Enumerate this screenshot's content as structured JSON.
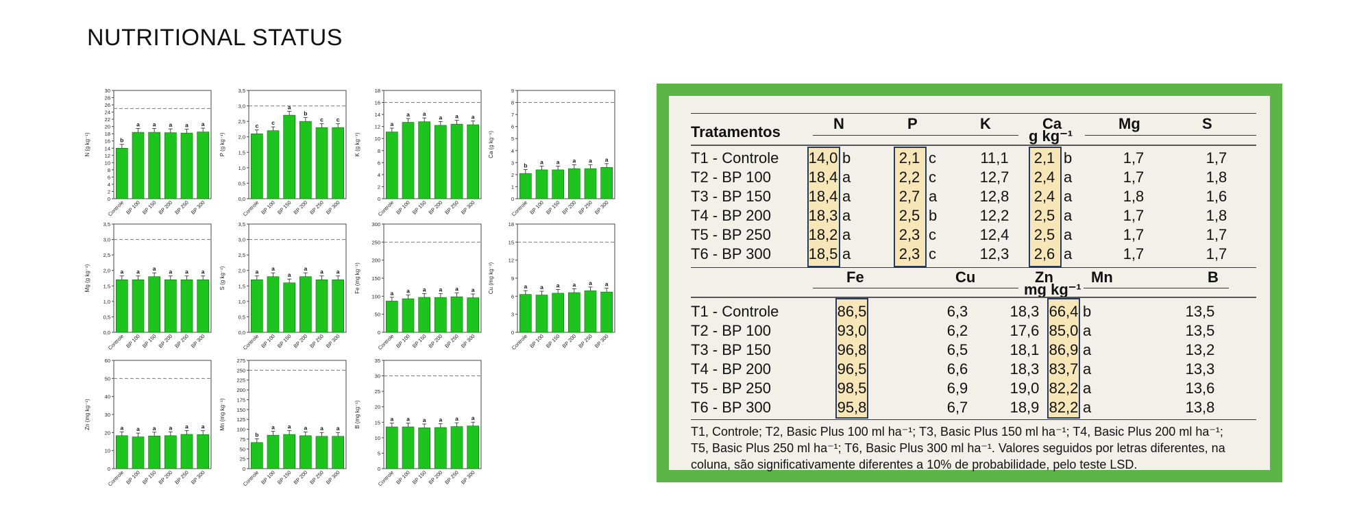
{
  "title": "NUTRITIONAL STATUS",
  "chart_data": [
    {
      "type": "bar",
      "ylabel": "N (g kg⁻¹)",
      "ylim": [
        0,
        30
      ],
      "yticks": [
        0,
        2,
        4,
        6,
        8,
        10,
        12,
        14,
        16,
        18,
        20,
        22,
        24,
        26,
        28,
        30
      ],
      "ref": 25,
      "categories": [
        "Controle",
        "BP 100",
        "BP 150",
        "BP 200",
        "BP 250",
        "BP 300"
      ],
      "values": [
        14.0,
        18.4,
        18.4,
        18.3,
        18.2,
        18.5
      ],
      "letters": [
        "b",
        "a",
        "a",
        "a",
        "a",
        "a"
      ]
    },
    {
      "type": "bar",
      "ylabel": "P (g kg⁻¹)",
      "ylim": [
        0,
        3.5
      ],
      "yticks": [
        0.0,
        0.5,
        1.0,
        1.5,
        2.0,
        2.5,
        3.0,
        3.5
      ],
      "ref": 3.0,
      "categories": [
        "Controle",
        "BP 100",
        "BP 150",
        "BP 200",
        "BP 250",
        "BP 300"
      ],
      "values": [
        2.1,
        2.2,
        2.7,
        2.5,
        2.3,
        2.3
      ],
      "letters": [
        "c",
        "c",
        "a",
        "b",
        "c",
        "c"
      ]
    },
    {
      "type": "bar",
      "ylabel": "K (g kg⁻¹)",
      "ylim": [
        0,
        18
      ],
      "yticks": [
        0,
        2,
        4,
        6,
        8,
        10,
        12,
        14,
        16,
        18
      ],
      "ref": 16,
      "categories": [
        "Controle",
        "BP 100",
        "BP 150",
        "BP 200",
        "BP 250",
        "BP 300"
      ],
      "values": [
        11.1,
        12.7,
        12.8,
        12.2,
        12.4,
        12.3
      ],
      "letters": [
        "a",
        "a",
        "a",
        "a",
        "a",
        "a"
      ]
    },
    {
      "type": "bar",
      "ylabel": "Ca (g kg⁻¹)",
      "ylim": [
        0,
        9
      ],
      "yticks": [
        0,
        1,
        2,
        3,
        4,
        5,
        6,
        7,
        8,
        9
      ],
      "ref": 8,
      "categories": [
        "Controle",
        "BP 100",
        "BP 150",
        "BP 200",
        "BP 250",
        "BP 300"
      ],
      "values": [
        2.1,
        2.4,
        2.4,
        2.5,
        2.5,
        2.6
      ],
      "letters": [
        "b",
        "a",
        "a",
        "a",
        "a",
        "a"
      ]
    },
    {
      "type": "bar",
      "ylabel": "Mg (g kg⁻¹)",
      "ylim": [
        0,
        3.5
      ],
      "yticks": [
        0.0,
        0.5,
        1.0,
        1.5,
        2.0,
        2.5,
        3.0,
        3.5
      ],
      "ref": 3.0,
      "categories": [
        "Controle",
        "BP 100",
        "BP 150",
        "BP 200",
        "BP 250",
        "BP 300"
      ],
      "values": [
        1.7,
        1.7,
        1.8,
        1.7,
        1.7,
        1.7
      ],
      "letters": [
        "a",
        "a",
        "a",
        "a",
        "a",
        "a"
      ]
    },
    {
      "type": "bar",
      "ylabel": "S (g kg⁻¹)",
      "ylim": [
        0,
        3.5
      ],
      "yticks": [
        0.0,
        0.5,
        1.0,
        1.5,
        2.0,
        2.5,
        3.0,
        3.5
      ],
      "ref": 3.0,
      "categories": [
        "Controle",
        "BP 100",
        "BP 150",
        "BP 200",
        "BP 250",
        "BP 300"
      ],
      "values": [
        1.7,
        1.8,
        1.6,
        1.8,
        1.7,
        1.7
      ],
      "letters": [
        "a",
        "a",
        "a",
        "a",
        "a",
        "a"
      ]
    },
    {
      "type": "bar",
      "ylabel": "Fe (mg kg⁻¹)",
      "ylim": [
        0,
        300
      ],
      "yticks": [
        0,
        50,
        100,
        150,
        200,
        250,
        300
      ],
      "ref": 250,
      "categories": [
        "Controle",
        "BP 100",
        "BP 150",
        "BP 200",
        "BP 250",
        "BP 300"
      ],
      "values": [
        86.5,
        93.0,
        96.8,
        96.5,
        98.5,
        95.8
      ],
      "letters": [
        "a",
        "a",
        "a",
        "a",
        "a",
        "a"
      ]
    },
    {
      "type": "bar",
      "ylabel": "Cu (mg kg⁻¹)",
      "ylim": [
        0,
        18
      ],
      "yticks": [
        0,
        3,
        6,
        9,
        12,
        15,
        18
      ],
      "ref": 15,
      "categories": [
        "Controle",
        "BP 100",
        "BP 150",
        "BP 200",
        "BP 250",
        "BP 300"
      ],
      "values": [
        6.3,
        6.2,
        6.5,
        6.6,
        6.9,
        6.7
      ],
      "letters": [
        "a",
        "a",
        "a",
        "a",
        "a",
        "a"
      ]
    },
    {
      "type": "bar",
      "ylabel": "Zn (mg kg⁻¹)",
      "ylim": [
        0,
        60
      ],
      "yticks": [
        0,
        10,
        20,
        30,
        40,
        50,
        60
      ],
      "ref": 50,
      "categories": [
        "Controle",
        "BP 100",
        "BP 150",
        "BP 200",
        "BP 250",
        "BP 300"
      ],
      "values": [
        18.3,
        17.6,
        18.1,
        18.3,
        19.0,
        18.9
      ],
      "letters": [
        "a",
        "a",
        "a",
        "a",
        "a",
        "a"
      ]
    },
    {
      "type": "bar",
      "ylabel": "Mn (mg kg⁻¹)",
      "ylim": [
        0,
        275
      ],
      "yticks": [
        0,
        25,
        50,
        75,
        100,
        125,
        150,
        175,
        200,
        225,
        250,
        275
      ],
      "ref": 250,
      "categories": [
        "Controle",
        "BP 100",
        "BP 150",
        "BP 200",
        "BP 250",
        "BP 300"
      ],
      "values": [
        66.4,
        85.0,
        86.9,
        83.7,
        82.2,
        82.2
      ],
      "letters": [
        "b",
        "a",
        "a",
        "a",
        "a",
        "a"
      ]
    },
    {
      "type": "bar",
      "ylabel": "B (mg kg⁻¹)",
      "ylim": [
        0,
        35
      ],
      "yticks": [
        0,
        5,
        10,
        15,
        20,
        25,
        30,
        35
      ],
      "ref": 30,
      "categories": [
        "Controle",
        "BP 100",
        "BP 150",
        "BP 200",
        "BP 250",
        "BP 300"
      ],
      "values": [
        13.5,
        13.5,
        13.2,
        13.3,
        13.6,
        13.8
      ],
      "letters": [
        "a",
        "a",
        "a",
        "a",
        "a",
        "a"
      ]
    }
  ],
  "table": {
    "row_header": "Tratamentos",
    "macro_cols": [
      "N",
      "P",
      "K",
      "Ca",
      "Mg",
      "S"
    ],
    "macro_unit": "g kg⁻¹",
    "rows": [
      "T1 - Controle",
      "T2 - BP 100",
      "T3 - BP 150",
      "T4 - BP 200",
      "T5 - BP 250",
      "T6 - BP 300"
    ],
    "macro": {
      "N": [
        "14,0",
        "18,4",
        "18,4",
        "18,3",
        "18,2",
        "18,5"
      ],
      "N_letters": [
        "b",
        "a",
        "a",
        "a",
        "a",
        "a"
      ],
      "P": [
        "2,1",
        "2,2",
        "2,7",
        "2,5",
        "2,3",
        "2,3"
      ],
      "P_letters": [
        "c",
        "c",
        "a",
        "b",
        "c",
        "c"
      ],
      "K": [
        "11,1",
        "12,7",
        "12,8",
        "12,2",
        "12,4",
        "12,3"
      ],
      "Ca": [
        "2,1",
        "2,4",
        "2,4",
        "2,5",
        "2,5",
        "2,6"
      ],
      "Ca_letters": [
        "b",
        "a",
        "a",
        "a",
        "a",
        "a"
      ],
      "Mg": [
        "1,7",
        "1,7",
        "1,8",
        "1,7",
        "1,7",
        "1,7"
      ],
      "S": [
        "1,7",
        "1,8",
        "1,6",
        "1,8",
        "1,7",
        "1,7"
      ]
    },
    "micro_cols": [
      "Fe",
      "Cu",
      "Zn",
      "Mn",
      "B"
    ],
    "micro_unit": "mg kg⁻¹",
    "micro": {
      "Fe": [
        "86,5",
        "93,0",
        "96,8",
        "96,5",
        "98,5",
        "95,8"
      ],
      "Cu": [
        "6,3",
        "6,2",
        "6,5",
        "6,6",
        "6,9",
        "6,7"
      ],
      "Zn": [
        "18,3",
        "17,6",
        "18,1",
        "18,3",
        "19,0",
        "18,9"
      ],
      "Mn": [
        "66,4",
        "85,0",
        "86,9",
        "83,7",
        "82,2",
        "82,2"
      ],
      "Mn_letters": [
        "b",
        "a",
        "a",
        "a",
        "a",
        "a"
      ],
      "B": [
        "13,5",
        "13,5",
        "13,2",
        "13,3",
        "13,6",
        "13,8"
      ]
    },
    "footnote": [
      "T1, Controle; T2, Basic Plus 100 ml ha⁻¹; T3, Basic Plus 150 ml ha⁻¹; T4, Basic Plus 200 ml ha⁻¹;",
      "T5, Basic Plus 250 ml ha⁻¹; T6, Basic Plus 300 ml ha⁻¹. Valores seguidos por letras diferentes, na",
      "coluna, são significativamente diferentes a 10% de probabilidade, pelo teste LSD."
    ]
  },
  "colors": {
    "bar": "#1ec41e",
    "bar_stroke": "#0d6e0d",
    "panel": "#5bb547",
    "highlight": "#f7e6b8",
    "highlight_border": "#243b63"
  }
}
